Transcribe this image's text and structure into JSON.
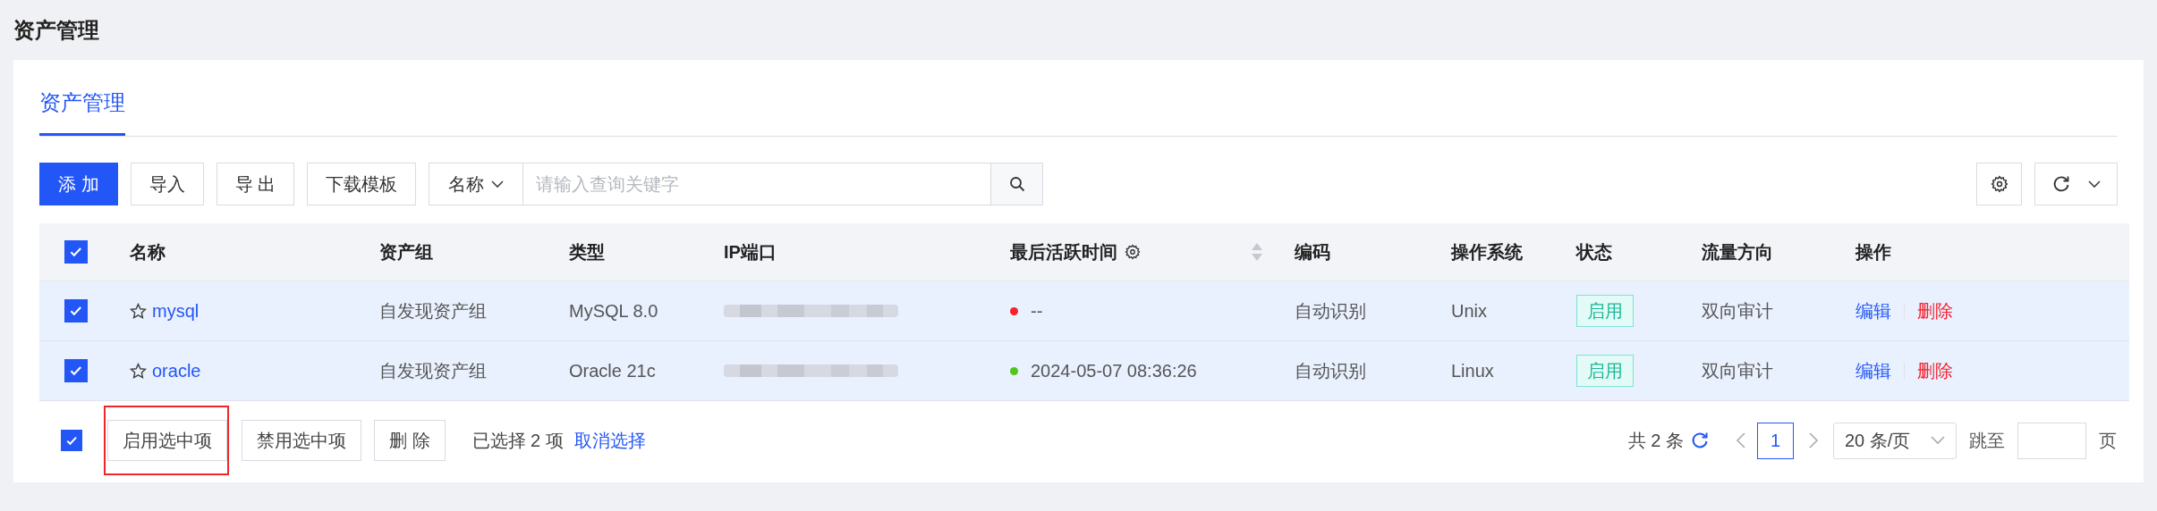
{
  "page_title": "资产管理",
  "tabs": [
    {
      "label": "资产管理",
      "selected": true
    }
  ],
  "toolbar": {
    "buttons": [
      {
        "label": "添 加",
        "kind": "primary"
      },
      {
        "label": "导入",
        "kind": "default"
      },
      {
        "label": "导 出",
        "kind": "default"
      },
      {
        "label": "下载模板",
        "kind": "default"
      }
    ],
    "search": {
      "field_select": "名称",
      "placeholder": "请输入查询关键字"
    }
  },
  "table": {
    "all_checked": true,
    "columns": [
      {
        "label": "名称"
      },
      {
        "label": "资产组"
      },
      {
        "label": "类型"
      },
      {
        "label": "IP端口"
      },
      {
        "label": "最后活跃时间",
        "settings": true,
        "sortable": true
      },
      {
        "label": "编码"
      },
      {
        "label": "操作系统"
      },
      {
        "label": "状态"
      },
      {
        "label": "流量方向"
      },
      {
        "label": "操作"
      }
    ],
    "rows": [
      {
        "checked": true,
        "starred": false,
        "name": "mysql",
        "group": "自发现资产组",
        "type": "MySQL 8.0",
        "last_active": "--",
        "color": "#f5222d",
        "code": "自动识别",
        "os": "Unix",
        "status": "启用",
        "flow": "双向审计",
        "actions": [
          {
            "label": "编辑",
            "kind": "edit"
          },
          {
            "label": "删除",
            "kind": "delete"
          }
        ]
      },
      {
        "checked": true,
        "starred": false,
        "name": "oracle",
        "group": "自发现资产组",
        "type": "Oracle 21c",
        "last_active": "2024-05-07 08:36:26",
        "color": "#52c41a",
        "code": "自动识别",
        "os": "Linux",
        "status": "启用",
        "flow": "双向审计",
        "actions": [
          {
            "label": "编辑",
            "kind": "edit"
          },
          {
            "label": "删除",
            "kind": "delete"
          }
        ]
      }
    ]
  },
  "footer": {
    "all_checked": true,
    "buttons": [
      {
        "label": "启用选中项",
        "highlighted": true
      },
      {
        "label": "禁用选中项",
        "highlighted": false
      },
      {
        "label": "删 除",
        "highlighted": false
      }
    ],
    "selection_text": "已选择 2 项",
    "clear_link": "取消选择"
  },
  "pagination": {
    "total": "共 2 条",
    "pages": [
      {
        "label": "1",
        "selected": true
      }
    ],
    "page_size": "20 条/页",
    "jump_label": "跳至",
    "jump_suffix": "页"
  }
}
